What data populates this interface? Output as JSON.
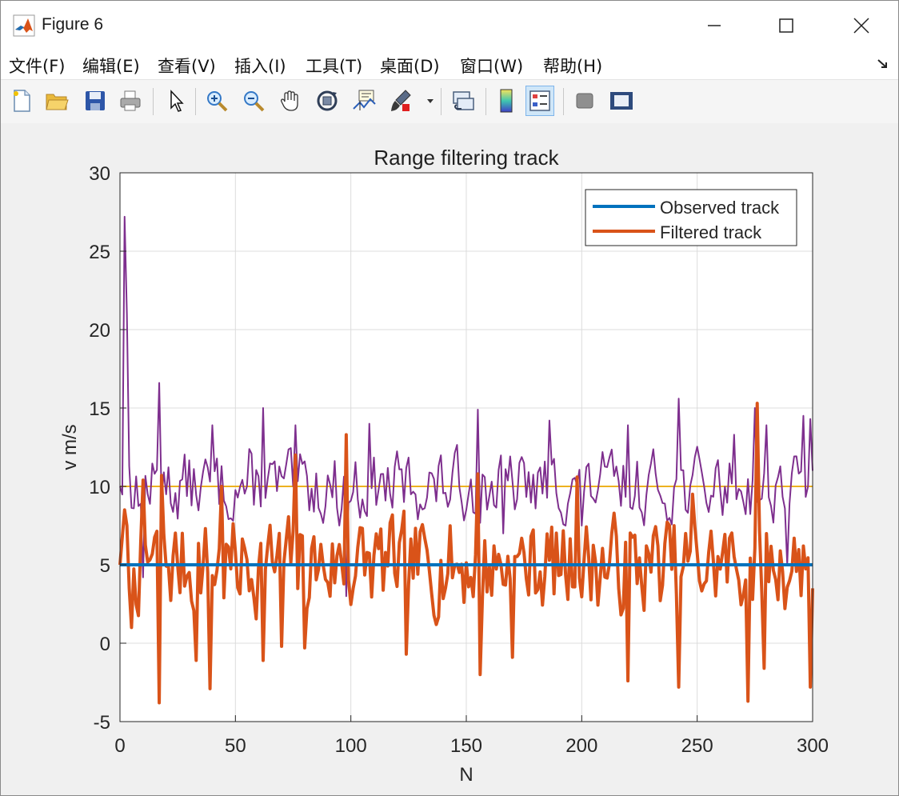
{
  "window": {
    "title": "Figure 6"
  },
  "menu": [
    "文件(F)",
    "编辑(E)",
    "查看(V)",
    "插入(I)",
    "工具(T)",
    "桌面(D)",
    "窗口(W)",
    "帮助(H)"
  ],
  "toolbar": {
    "icons": [
      "new-figure-icon",
      "open-file-icon",
      "save-icon",
      "print-icon",
      "select-arrow-icon",
      "zoom-in-icon",
      "zoom-out-icon",
      "pan-hand-icon",
      "rotate-3d-icon",
      "data-cursor-icon",
      "brush-icon",
      "link-plot-icon",
      "colorbar-icon",
      "legend-icon",
      "hide-plot-tools-icon",
      "show-plot-tools-icon"
    ]
  },
  "chart_data": {
    "type": "line",
    "title": "Range filtering track",
    "xlabel": "N",
    "ylabel": "v m/s",
    "xlim": [
      0,
      300
    ],
    "ylim": [
      -5,
      30
    ],
    "xticks": [
      "0",
      "50",
      "100",
      "150",
      "200",
      "250",
      "300"
    ],
    "yticks": [
      "-5",
      "0",
      "5",
      "10",
      "15",
      "20",
      "25",
      "30"
    ],
    "grid": true,
    "legend_position": "top-right",
    "legend": [
      "Observed track",
      "Filtered track"
    ],
    "series": [
      {
        "name": "Observed track",
        "color": "#0072BD",
        "constant": 5
      },
      {
        "name": "Filtered track",
        "color": "#D95319",
        "seed": 7,
        "mean": 5,
        "spread": 4.2,
        "peaks": [
          [
            0,
            5.0
          ],
          [
            2,
            8.5
          ],
          [
            3,
            7.5
          ],
          [
            5,
            1.0
          ],
          [
            10,
            10.4
          ],
          [
            17,
            -3.8
          ],
          [
            18,
            10.7
          ],
          [
            33,
            -1.1
          ],
          [
            39,
            -2.9
          ],
          [
            44,
            10.0
          ],
          [
            62,
            -1.1
          ],
          [
            70,
            -0.2
          ],
          [
            76,
            12.0
          ],
          [
            80,
            -0.3
          ],
          [
            98,
            13.3
          ],
          [
            124,
            -0.7
          ],
          [
            155,
            10.8
          ],
          [
            156,
            -2.0
          ],
          [
            170,
            -0.9
          ],
          [
            198,
            10.6
          ],
          [
            220,
            -2.4
          ],
          [
            242,
            -2.8
          ],
          [
            248,
            9.5
          ],
          [
            272,
            -3.7
          ],
          [
            276,
            15.3
          ],
          [
            279,
            -1.6
          ],
          [
            296,
            6.2
          ],
          [
            299,
            -2.8
          ],
          [
            300,
            3.5
          ]
        ]
      },
      {
        "name": "",
        "color": "#EDB120",
        "constant": 10
      },
      {
        "name": "",
        "color": "#7E2F8E",
        "seed": 13,
        "mean": 10,
        "spread": 3.0,
        "peaks": [
          [
            0,
            10.0
          ],
          [
            2,
            27.2
          ],
          [
            3,
            21.0
          ],
          [
            4,
            11.3
          ],
          [
            6,
            8.6
          ],
          [
            10,
            4.2
          ],
          [
            17,
            16.6
          ],
          [
            19,
            10.9
          ],
          [
            40,
            13.9
          ],
          [
            55,
            10.0
          ],
          [
            62,
            15.0
          ],
          [
            72,
            11.4
          ],
          [
            76,
            13.9
          ],
          [
            95,
            7.5
          ],
          [
            98,
            3.0
          ],
          [
            108,
            14.0
          ],
          [
            155,
            14.9
          ],
          [
            166,
            7.0
          ],
          [
            186,
            14.2
          ],
          [
            200,
            7.5
          ],
          [
            220,
            13.9
          ],
          [
            242,
            15.6
          ],
          [
            266,
            13.3
          ],
          [
            275,
            15.0
          ],
          [
            280,
            13.9
          ],
          [
            289,
            5.0
          ],
          [
            296,
            14.5
          ],
          [
            298,
            10.0
          ],
          [
            299,
            14.3
          ],
          [
            300,
            11.0
          ]
        ]
      }
    ]
  }
}
